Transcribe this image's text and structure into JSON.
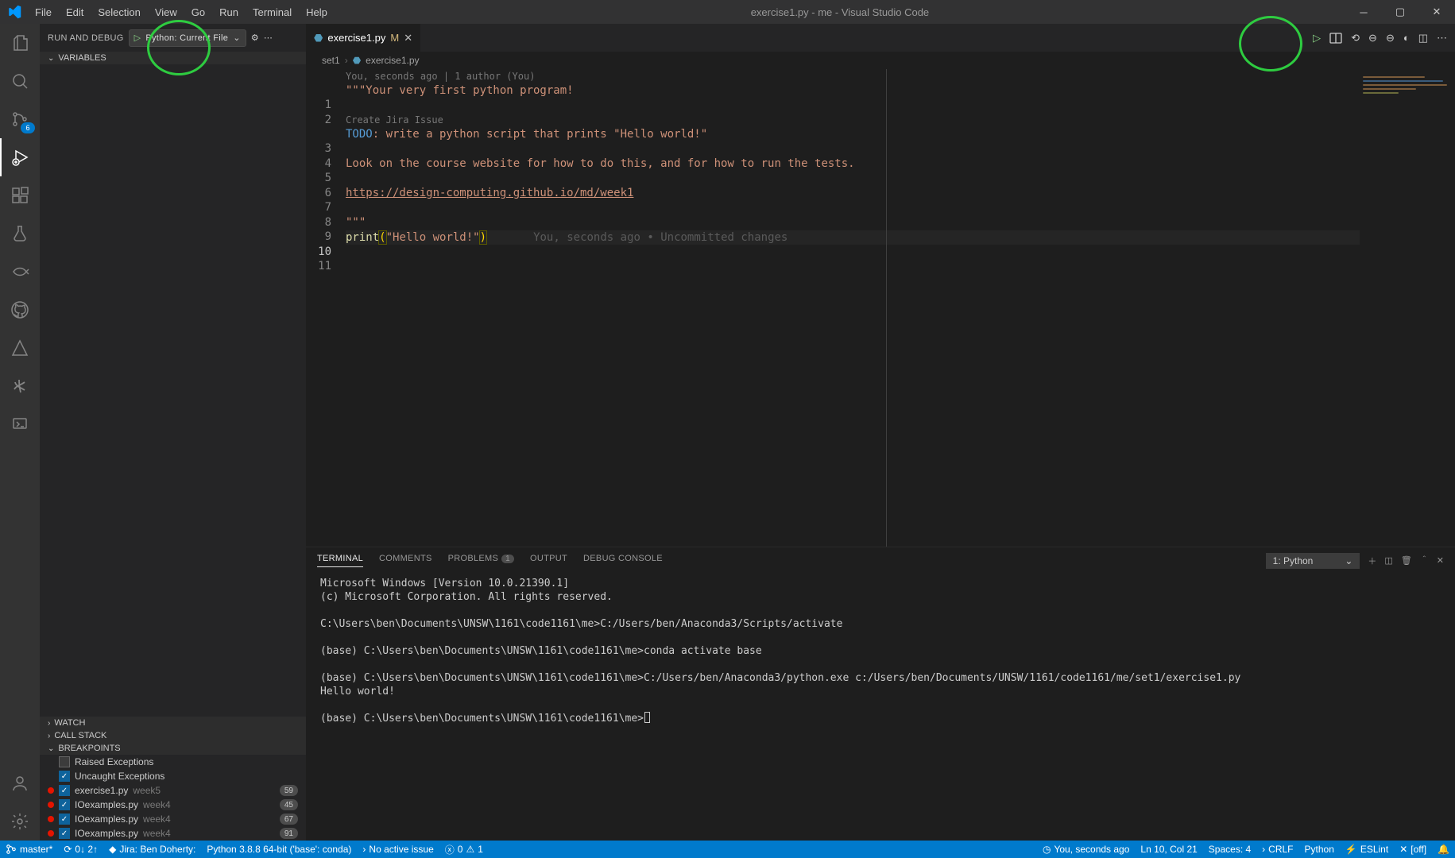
{
  "title": "exercise1.py - me - Visual Studio Code",
  "menu": [
    "File",
    "Edit",
    "Selection",
    "View",
    "Go",
    "Run",
    "Terminal",
    "Help"
  ],
  "activity_badge": "6",
  "sidebar": {
    "panel": "RUN AND DEBUG",
    "config": "Python: Current File",
    "sections": {
      "variables": "VARIABLES",
      "watch": "WATCH",
      "callstack": "CALL STACK",
      "breakpoints": "BREAKPOINTS"
    },
    "bp_opts": {
      "raised": "Raised Exceptions",
      "uncaught": "Uncaught Exceptions"
    },
    "breakpoints": [
      {
        "file": "exercise1.py",
        "meta": "week5",
        "count": "59"
      },
      {
        "file": "IOexamples.py",
        "meta": "week4",
        "count": "45"
      },
      {
        "file": "IOexamples.py",
        "meta": "week4",
        "count": "67"
      },
      {
        "file": "IOexamples.py",
        "meta": "week4",
        "count": "91"
      }
    ]
  },
  "tab": {
    "file": "exercise1.py",
    "modified": "M"
  },
  "crumbs": {
    "a": "set1",
    "b": "exercise1.py"
  },
  "code": {
    "lens_blame": "You, seconds ago | 1 author (You)",
    "lens_jira": "Create Jira Issue",
    "l1": "\"\"\"Your very first python program!",
    "l3_todo": "TODO",
    "l3_rest": ": write a python script that prints \"Hello world!\"",
    "l5": "Look on the course website for how to do this, and for how to run the tests.",
    "l7": "https://design-computing.github.io/md/week1",
    "l9": "\"\"\"",
    "print": "print",
    "hello": "\"Hello world!\"",
    "blame10": "You, seconds ago • Uncommitted changes"
  },
  "panel": {
    "tabs": {
      "terminal": "TERMINAL",
      "comments": "COMMENTS",
      "problems": "PROBLEMS",
      "problems_badge": "1",
      "output": "OUTPUT",
      "debug": "DEBUG CONSOLE"
    },
    "term_dd": "1: Python",
    "terminal": "Microsoft Windows [Version 10.0.21390.1]\n(c) Microsoft Corporation. All rights reserved.\n\nC:\\Users\\ben\\Documents\\UNSW\\1161\\code1161\\me>C:/Users/ben/Anaconda3/Scripts/activate\n\n(base) C:\\Users\\ben\\Documents\\UNSW\\1161\\code1161\\me>conda activate base\n\n(base) C:\\Users\\ben\\Documents\\UNSW\\1161\\code1161\\me>C:/Users/ben/Anaconda3/python.exe c:/Users/ben/Documents/UNSW/1161/code1161/me/set1/exercise1.py\nHello world!\n\n(base) C:\\Users\\ben\\Documents\\UNSW\\1161\\code1161\\me>"
  },
  "status": {
    "branch": "master*",
    "sync": "0↓ 2↑",
    "jira": "Jira: Ben Doherty:",
    "python": "Python 3.8.8 64-bit ('base': conda)",
    "issue": "No active issue",
    "err": "0",
    "warn": "1",
    "blame": "You, seconds ago",
    "pos": "Ln 10, Col 21",
    "spaces": "Spaces: 4",
    "eol": "CRLF",
    "lang": "Python",
    "lint": "ESLint",
    "prettier": "[off]"
  }
}
